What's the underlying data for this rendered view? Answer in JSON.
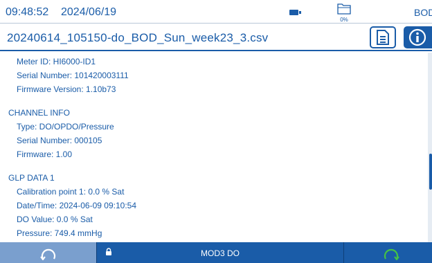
{
  "status": {
    "time": "09:48:52",
    "date": "2024/06/19",
    "mode": "BOD",
    "storage_percent": "0%",
    "battery_icon": "battery-icon",
    "storage_icon": "folder-icon"
  },
  "title": {
    "filename": "20240614_105150-do_BOD_Sun_week23_3.csv"
  },
  "content": {
    "meter": {
      "meter_id": "Meter ID: HI6000-ID1",
      "serial": "Serial Number: 101420003111",
      "firmware": "Firmware Version: 1.10b73"
    },
    "channel": {
      "heading": "CHANNEL INFO",
      "type": "Type: DO/OPDO/Pressure",
      "serial": "Serial Number: 000105",
      "firmware": "Firmware: 1.00"
    },
    "glp": {
      "heading": "GLP DATA 1",
      "cal_point": "Calibration point 1: 0.0 % Sat",
      "datetime": "Date/Time: 2024-06-09 09:10:54",
      "do_value": "DO Value: 0.0 % Sat",
      "pressure": "Pressure: 749.4 mmHg"
    }
  },
  "bottom": {
    "center_label": "MOD3 DO",
    "left_icon": "refresh-icon",
    "right_icon": "refresh-icon"
  },
  "colors": {
    "accent": "#1a5ca8",
    "inactive_button": "#7a9fce",
    "background": "#ffffff"
  }
}
